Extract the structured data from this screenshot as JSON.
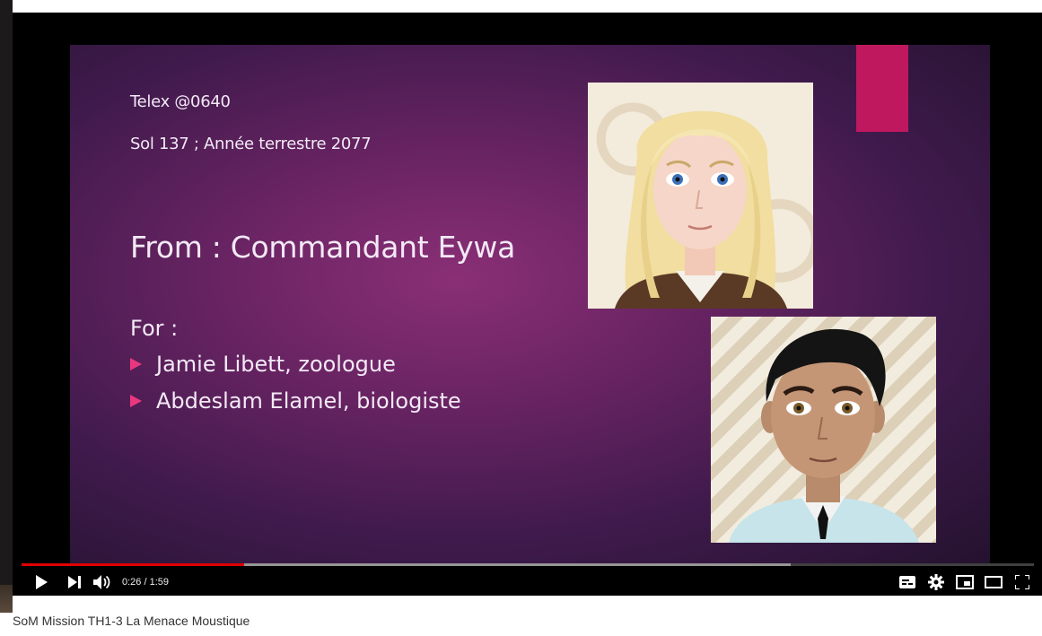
{
  "video": {
    "slide": {
      "telex": "Telex @0640",
      "sol": "Sol 137 ; Année terrestre 2077",
      "from": "From : Commandant Eywa",
      "for_label": "For :",
      "recipients": [
        "Jamie Libett, zoologue",
        "Abdeslam Elamel, biologiste"
      ],
      "accent_color": "#c0185f",
      "bullet_color": "#e8377f"
    },
    "player": {
      "current_time": "0:26",
      "duration": "1:59",
      "time_display": "0:26 / 1:59",
      "played_fraction": 0.22,
      "buffered_fraction": 0.76,
      "progress_color": "#e00000",
      "icons": {
        "play": "play-icon",
        "next": "next-icon",
        "volume": "volume-icon",
        "subtitles": "subtitles-icon",
        "settings": "gear-icon",
        "miniplayer": "miniplayer-icon",
        "theater": "theater-icon",
        "fullscreen": "fullscreen-icon"
      }
    }
  },
  "title": "SoM Mission TH1-3 La Menace Moustique"
}
